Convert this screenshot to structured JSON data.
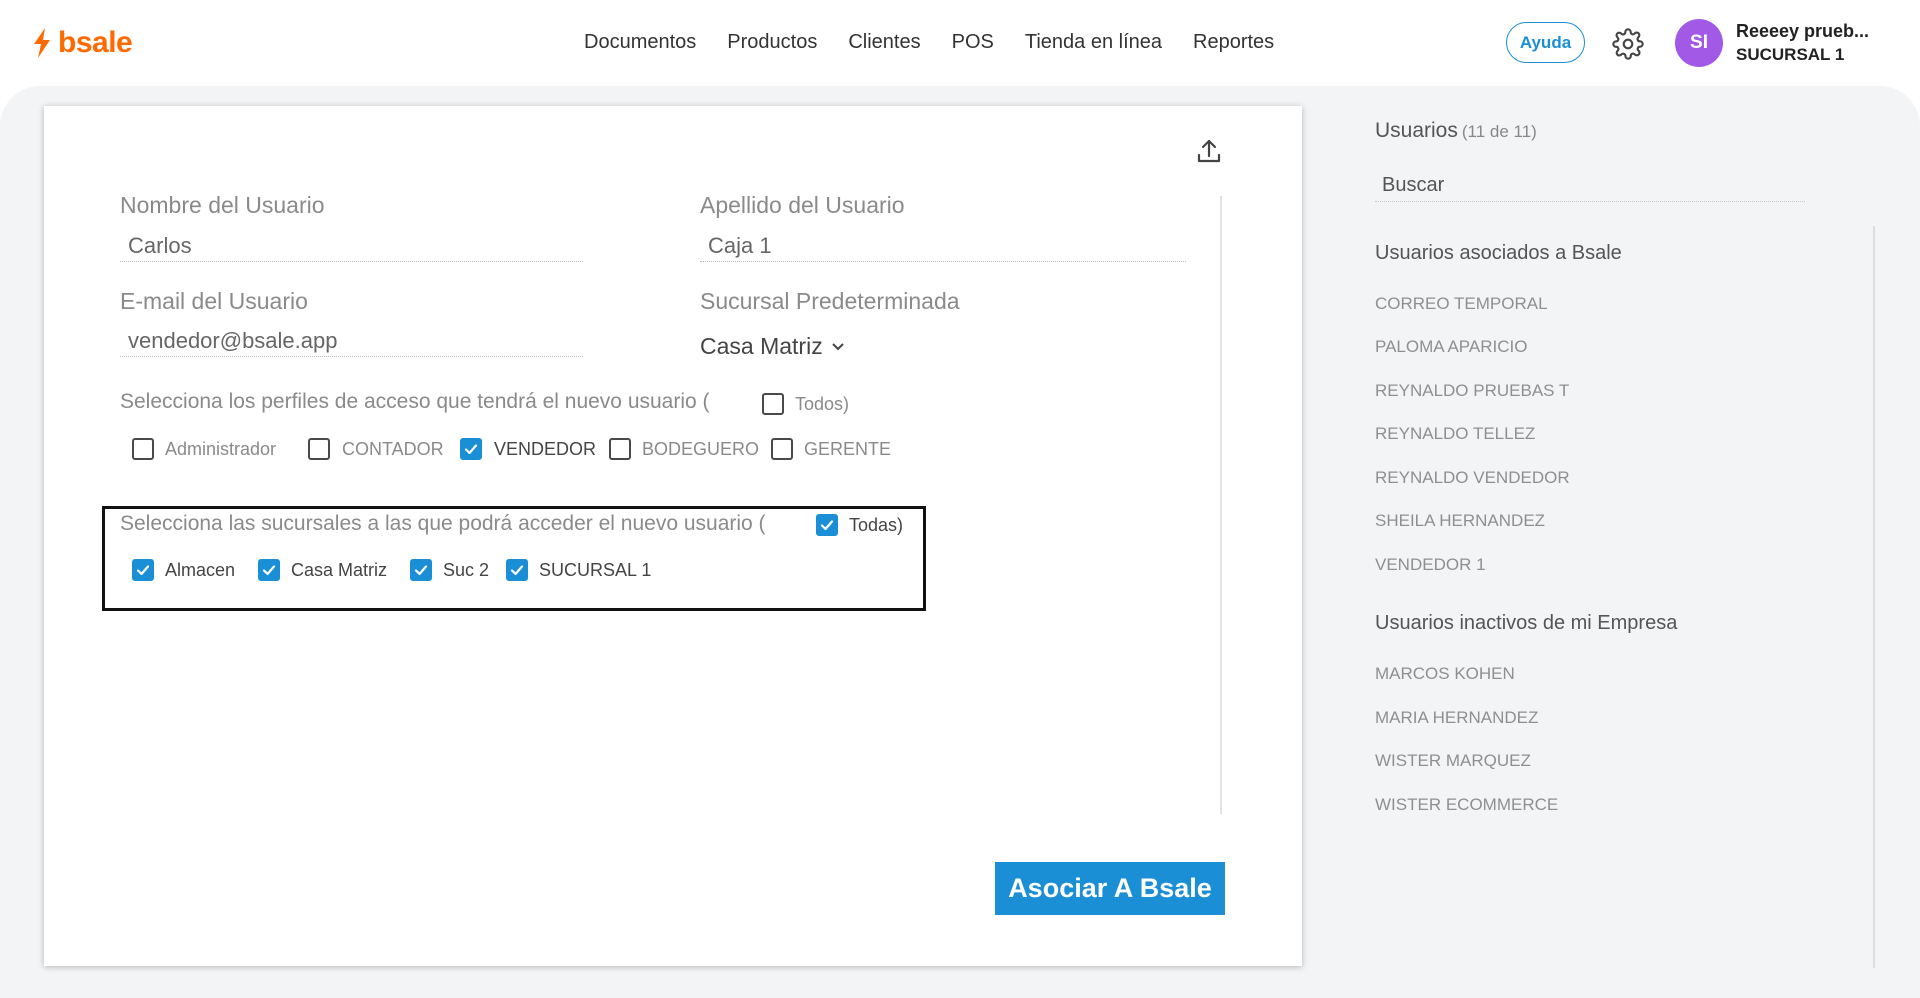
{
  "brand": {
    "name": "bsale",
    "color": "#ff6a00"
  },
  "nav": [
    "Documentos",
    "Productos",
    "Clientes",
    "POS",
    "Tienda en línea",
    "Reportes"
  ],
  "header": {
    "help_label": "Ayuda",
    "avatar_initials": "SI",
    "user_name": "Reeeey prueb...",
    "user_branch": "SUCURSAL 1"
  },
  "form": {
    "first_name_label": "Nombre del Usuario",
    "first_name_value": "Carlos",
    "last_name_label": "Apellido del Usuario",
    "last_name_value": "Caja 1",
    "email_label": "E-mail del Usuario",
    "email_value": "vendedor@bsale.app",
    "branch_label": "Sucursal Predeterminada",
    "branch_value": "Casa Matriz",
    "profiles_prompt": "Selecciona los perfiles de acceso que tendrá el nuevo usuario (",
    "profiles_all_label": "Todos)",
    "profiles_all_checked": false,
    "profiles": [
      {
        "label": "Administrador",
        "checked": false
      },
      {
        "label": "CONTADOR",
        "checked": false
      },
      {
        "label": "VENDEDOR",
        "checked": true
      },
      {
        "label": "BODEGUERO",
        "checked": false
      },
      {
        "label": "GERENTE",
        "checked": false
      }
    ],
    "branches_prompt": "Selecciona las sucursales a las que podrá acceder el nuevo usuario (",
    "branches_all_label": "Todas)",
    "branches_all_checked": true,
    "branches": [
      {
        "label": "Almacen",
        "checked": true
      },
      {
        "label": "Casa Matriz",
        "checked": true
      },
      {
        "label": "Suc 2",
        "checked": true
      },
      {
        "label": "SUCURSAL 1",
        "checked": true
      }
    ],
    "submit_label": "Asociar A Bsale"
  },
  "users_panel": {
    "title": "Usuarios",
    "count": "(11 de 11)",
    "search_label": "Buscar",
    "associated_title": "Usuarios asociados a Bsale",
    "associated": [
      "CORREO TEMPORAL",
      "PALOMA APARICIO",
      "REYNALDO PRUEBAS T",
      "REYNALDO TELLEZ",
      "REYNALDO VENDEDOR",
      "SHEILA HERNANDEZ",
      "VENDEDOR 1"
    ],
    "inactive_title": "Usuarios inactivos de mi Empresa",
    "inactive": [
      "MARCOS KOHEN",
      "MARIA HERNANDEZ",
      "WISTER MARQUEZ",
      "WISTER ECOMMERCE"
    ]
  },
  "colors": {
    "accent": "#1a8fd6",
    "avatar": "#a259e6",
    "highlight_border": "#111111"
  }
}
